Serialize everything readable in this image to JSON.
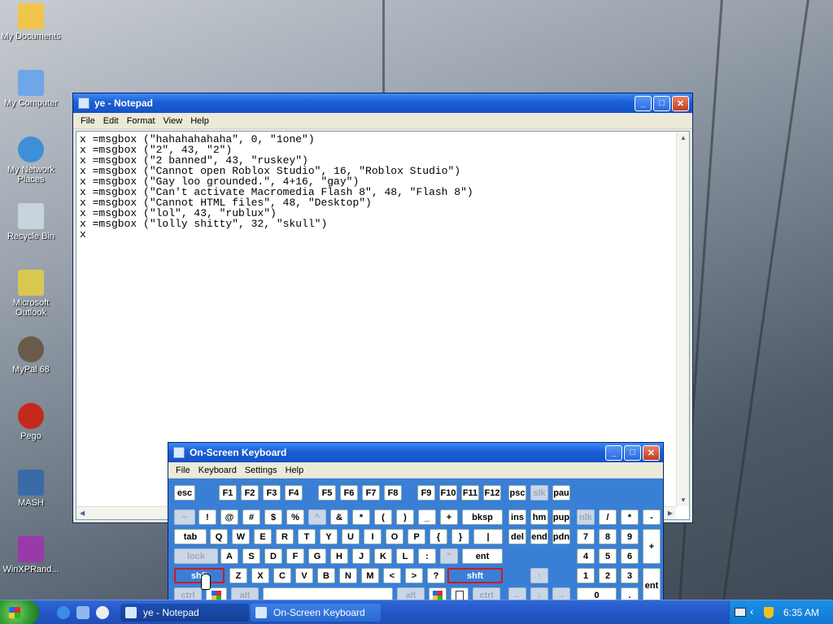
{
  "desktop": {
    "icons": [
      {
        "label": "My Documents",
        "color": "#f0c64a"
      },
      {
        "label": "My Computer",
        "color": "#6fa6e8"
      },
      {
        "label": "My Network Places",
        "color": "#3d8fd8"
      },
      {
        "label": "Recycle Bin",
        "color": "#c9d3dc"
      },
      {
        "label": "Microsoft Outlook",
        "color": "#d8c850"
      },
      {
        "label": "MyPal 68",
        "color": "#6a5a4a"
      },
      {
        "label": "Pego",
        "color": "#c42a1c"
      },
      {
        "label": "MASH",
        "color": "#3a6aa8"
      },
      {
        "label": "WinXPRand...",
        "color": "#9a3aa8"
      }
    ]
  },
  "notepad": {
    "title": "ye - Notepad",
    "menu": [
      "File",
      "Edit",
      "Format",
      "View",
      "Help"
    ],
    "lines": [
      "x =msgbox (\"hahahahahaha\", 0, \"1one\")",
      "x =msgbox (\"2\", 43, \"2\")",
      "x =msgbox (\"2 banned\", 43, \"ruskey\")",
      "x =msgbox (\"Cannot open Roblox Studio\", 16, \"Roblox Studio\")",
      "x =msgbox (\"Gay loo grounded.\", 4+16, \"gay\")",
      "x =msgbox (\"Can't activate Macromedia Flash 8\", 48, \"Flash 8\")",
      "x =msgbox (\"Cannot HTML files\", 48, \"Desktop\")",
      "x =msgbox (\"lol\", 43, \"rublux\")",
      "x =msgbox (\"lolly shitty\", 32, \"skull\")",
      "x"
    ]
  },
  "osk": {
    "title": "On-Screen Keyboard",
    "menu": [
      "File",
      "Keyboard",
      "Settings",
      "Help"
    ],
    "keys": {
      "esc": "esc",
      "f1": "F1",
      "f2": "F2",
      "f3": "F3",
      "f4": "F4",
      "f5": "F5",
      "f6": "F6",
      "f7": "F7",
      "f8": "F8",
      "f9": "F9",
      "f10": "F10",
      "f11": "F11",
      "f12": "F12",
      "psc": "psc",
      "slk": "slk",
      "pau": "pau",
      "tilde": "~",
      "excl": "!",
      "at": "@",
      "hash": "#",
      "dollar": "$",
      "pct": "%",
      "caret": "^",
      "amp": "&",
      "star": "*",
      "lpar": "(",
      "rpar": ")",
      "under": "_",
      "plus": "+",
      "bksp": "bksp",
      "ins": "ins",
      "hm": "hm",
      "pup": "pup",
      "nlk": "nlk",
      "slash": "/",
      "mult": "*",
      "minus": "-",
      "tab": "tab",
      "Q": "Q",
      "W": "W",
      "E": "E",
      "R": "R",
      "T": "T",
      "Y": "Y",
      "U": "U",
      "I": "I",
      "O": "O",
      "P": "P",
      "lbrace": "{",
      "rbrace": "}",
      "pipe": "|",
      "del": "del",
      "end": "end",
      "pdn": "pdn",
      "n7": "7",
      "n8": "8",
      "n9": "9",
      "nplus": "+",
      "lock": "lock",
      "A": "A",
      "S": "S",
      "D": "D",
      "F": "F",
      "G": "G",
      "H": "H",
      "J": "J",
      "K": "K",
      "L": "L",
      "colon": ":",
      "quote": "\"",
      "ent": "ent",
      "n4": "4",
      "n5": "5",
      "n6": "6",
      "shft": "shft",
      "Z": "Z",
      "X": "X",
      "C": "C",
      "V": "V",
      "B": "B",
      "N": "N",
      "M": "M",
      "lt": "<",
      "gt": ">",
      "qm": "?",
      "shft2": "shft",
      "up": "↑",
      "n1": "1",
      "n2": "2",
      "n3": "3",
      "nent": "ent",
      "ctrl": "ctrl",
      "alt": "alt",
      "alt2": "alt",
      "ctrl2": "ctrl",
      "left": "←",
      "down": "↓",
      "right": "→",
      "n0": "0",
      "ndot": "."
    }
  },
  "taskbar": {
    "tasks": [
      "ye - Notepad",
      "On-Screen Keyboard"
    ],
    "clock": "6:35 AM"
  }
}
